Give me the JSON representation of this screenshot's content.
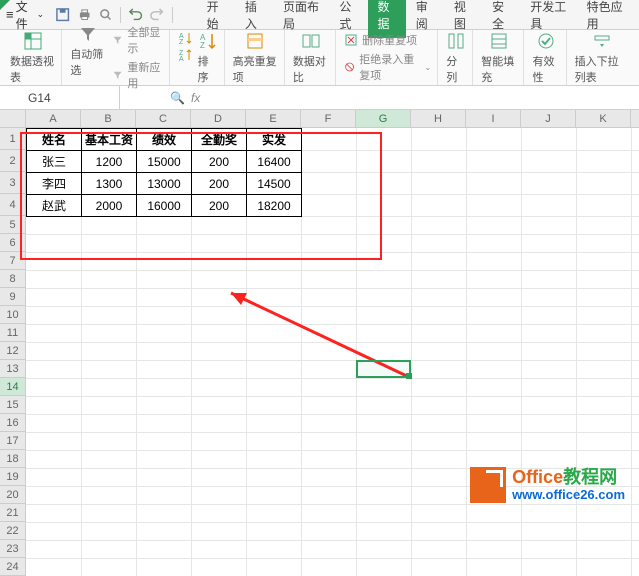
{
  "titlebar": {
    "file_label": "文件",
    "tabs": [
      "开始",
      "插入",
      "页面布局",
      "公式",
      "数据",
      "审阅",
      "视图",
      "安全",
      "开发工具",
      "特色应用"
    ],
    "active_tab_index": 4
  },
  "ribbon": {
    "pivot": "数据透视表",
    "filter": "自动筛选",
    "show_all": "全部显示",
    "reapply": "重新应用",
    "sort": "排序",
    "highlight_dup": "高亮重复项",
    "data_compare": "数据对比",
    "remove_dup": "删除重复项",
    "reject_dup": "拒绝录入重复项",
    "text_to_col": "分列",
    "smart_fill": "智能填充",
    "validation": "有效性",
    "insert_dropdown": "插入下拉列表"
  },
  "formula_bar": {
    "name_box": "G14",
    "formula": ""
  },
  "columns": [
    "A",
    "B",
    "C",
    "D",
    "E",
    "F",
    "G",
    "H",
    "I",
    "J",
    "K"
  ],
  "rows": [
    "1",
    "2",
    "3",
    "4",
    "5",
    "6",
    "7",
    "8",
    "9",
    "10",
    "11",
    "12",
    "13",
    "14",
    "15",
    "16",
    "17",
    "18",
    "19",
    "20",
    "21",
    "22",
    "23",
    "24"
  ],
  "data_headers": [
    "姓名",
    "基本工资",
    "绩效",
    "全勤奖",
    "实发"
  ],
  "data_rows": [
    [
      "张三",
      "1200",
      "15000",
      "200",
      "16400"
    ],
    [
      "李四",
      "1300",
      "13000",
      "200",
      "14500"
    ],
    [
      "赵武",
      "2000",
      "16000",
      "200",
      "18200"
    ]
  ],
  "selected_col": "G",
  "selected_row": "14",
  "watermark": {
    "title_prefix": "Office",
    "title_suffix": "教程网",
    "url": "www.office26.com"
  }
}
